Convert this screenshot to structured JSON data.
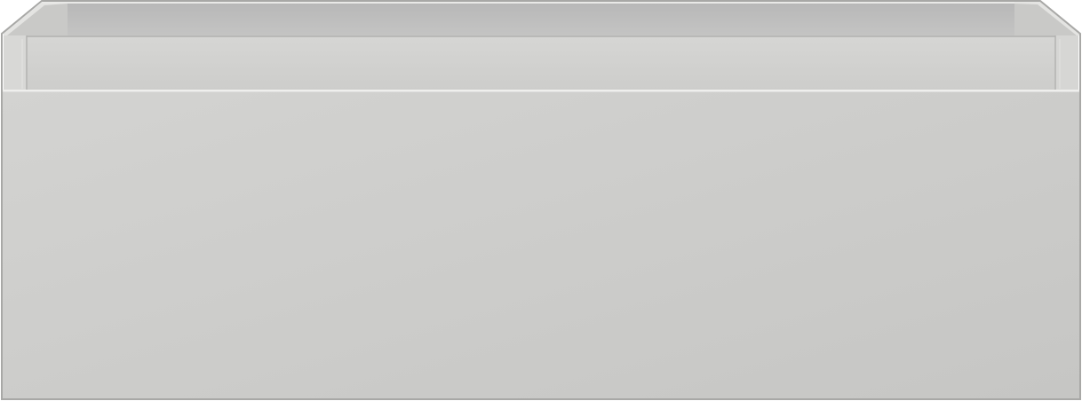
{
  "object": {
    "name": "drawer-box",
    "colors": {
      "front_top": "#d2d2d0",
      "front_bottom": "#c7c7c5",
      "back_wall": "#bdbdbd",
      "side_wall": "#d0d0ce",
      "rim": "#e8e8e6",
      "edge": "#b5b5b3",
      "outline": "#a9a9a7"
    }
  }
}
